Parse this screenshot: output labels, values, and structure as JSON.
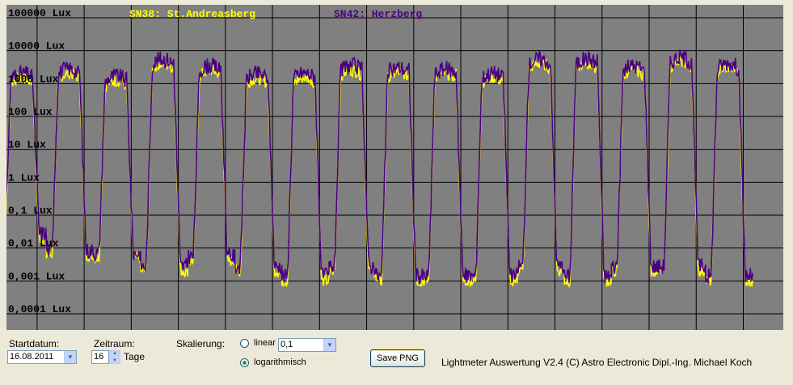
{
  "chart_data": {
    "type": "line",
    "series": [
      {
        "name": "SN38: St.Andreasberg",
        "color": "#ffff00"
      },
      {
        "name": "SN42: Herzberg",
        "color": "#4b0082"
      }
    ],
    "y_scale": "log",
    "y_range": [
      0.0001,
      100000
    ],
    "y_tick_labels": [
      "100000 Lux",
      "10000 Lux",
      "1000 Lux",
      "100 Lux",
      "10 Lux",
      "1 Lux",
      "0,1 Lux",
      "0,01 Lux",
      "0,001 Lux",
      "0,0001 Lux"
    ],
    "x_days": 16,
    "grid": true,
    "days": [
      {
        "day": 1,
        "night": 0.02,
        "peak": 1500
      },
      {
        "day": 2,
        "night": 0.006,
        "peak": 2000
      },
      {
        "day": 3,
        "night": 0.005,
        "peak": 1200
      },
      {
        "day": 4,
        "night": 0.002,
        "peak": 4000
      },
      {
        "day": 5,
        "night": 0.004,
        "peak": 2500
      },
      {
        "day": 6,
        "night": 0.002,
        "peak": 1400
      },
      {
        "day": 7,
        "night": 0.001,
        "peak": 1500
      },
      {
        "day": 8,
        "night": 0.002,
        "peak": 2500
      },
      {
        "day": 9,
        "night": 0.001,
        "peak": 2200
      },
      {
        "day": 10,
        "night": 0.001,
        "peak": 2000
      },
      {
        "day": 11,
        "night": 0.001,
        "peak": 1500
      },
      {
        "day": 12,
        "night": 0.002,
        "peak": 4000
      },
      {
        "day": 13,
        "night": 0.001,
        "peak": 4000
      },
      {
        "day": 14,
        "night": 0.002,
        "peak": 2500
      },
      {
        "day": 15,
        "night": 0.002,
        "peak": 4500
      },
      {
        "day": 16,
        "night": 0.001,
        "peak": 3000
      }
    ]
  },
  "controls": {
    "startdatum_label": "Startdatum:",
    "startdatum_value": "16.08.2011",
    "zeitraum_label": "Zeitraum:",
    "zeitraum_value": "16",
    "zeitraum_unit": "Tage",
    "skalierung_label": "Skalierung:",
    "linear_label": "linear",
    "linear_value": "0,1",
    "log_label": "logarithmisch",
    "save_label": "Save PNG",
    "footer": "Lightmeter Auswertung V2.4  (C) Astro Electronic Dipl.-Ing. Michael Koch"
  }
}
